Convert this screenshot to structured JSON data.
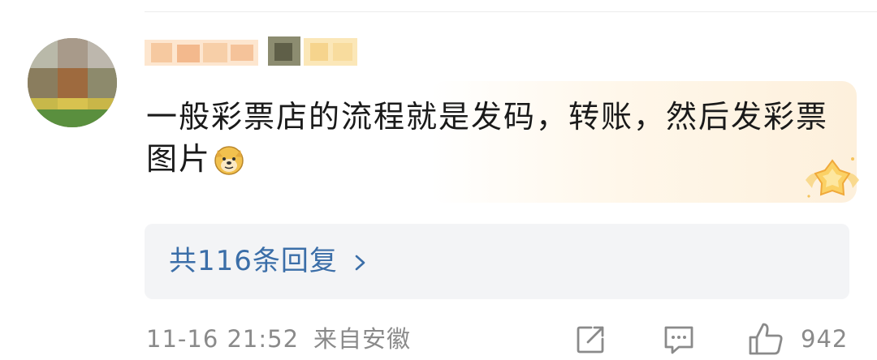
{
  "comment": {
    "username_visible": false,
    "text": "一般彩票店的流程就是发码，转账，然后发彩票图片",
    "emoji": "doge-emoji",
    "badge": "star-badge"
  },
  "replies": {
    "label": "共116条回复",
    "chevron": "chevron-right-icon"
  },
  "footer": {
    "time": "11-16 21:52",
    "location": "来自安徽",
    "share_icon": "share-icon",
    "comment_icon": "comment-icon",
    "like_icon": "thumbs-up-icon",
    "like_count": "942"
  },
  "colors": {
    "text": "#1a1a1a",
    "link": "#3b6ea8",
    "meta": "#8a8a8a",
    "reply_bg": "#f3f4f6",
    "highlight": "#fdf0dc"
  }
}
